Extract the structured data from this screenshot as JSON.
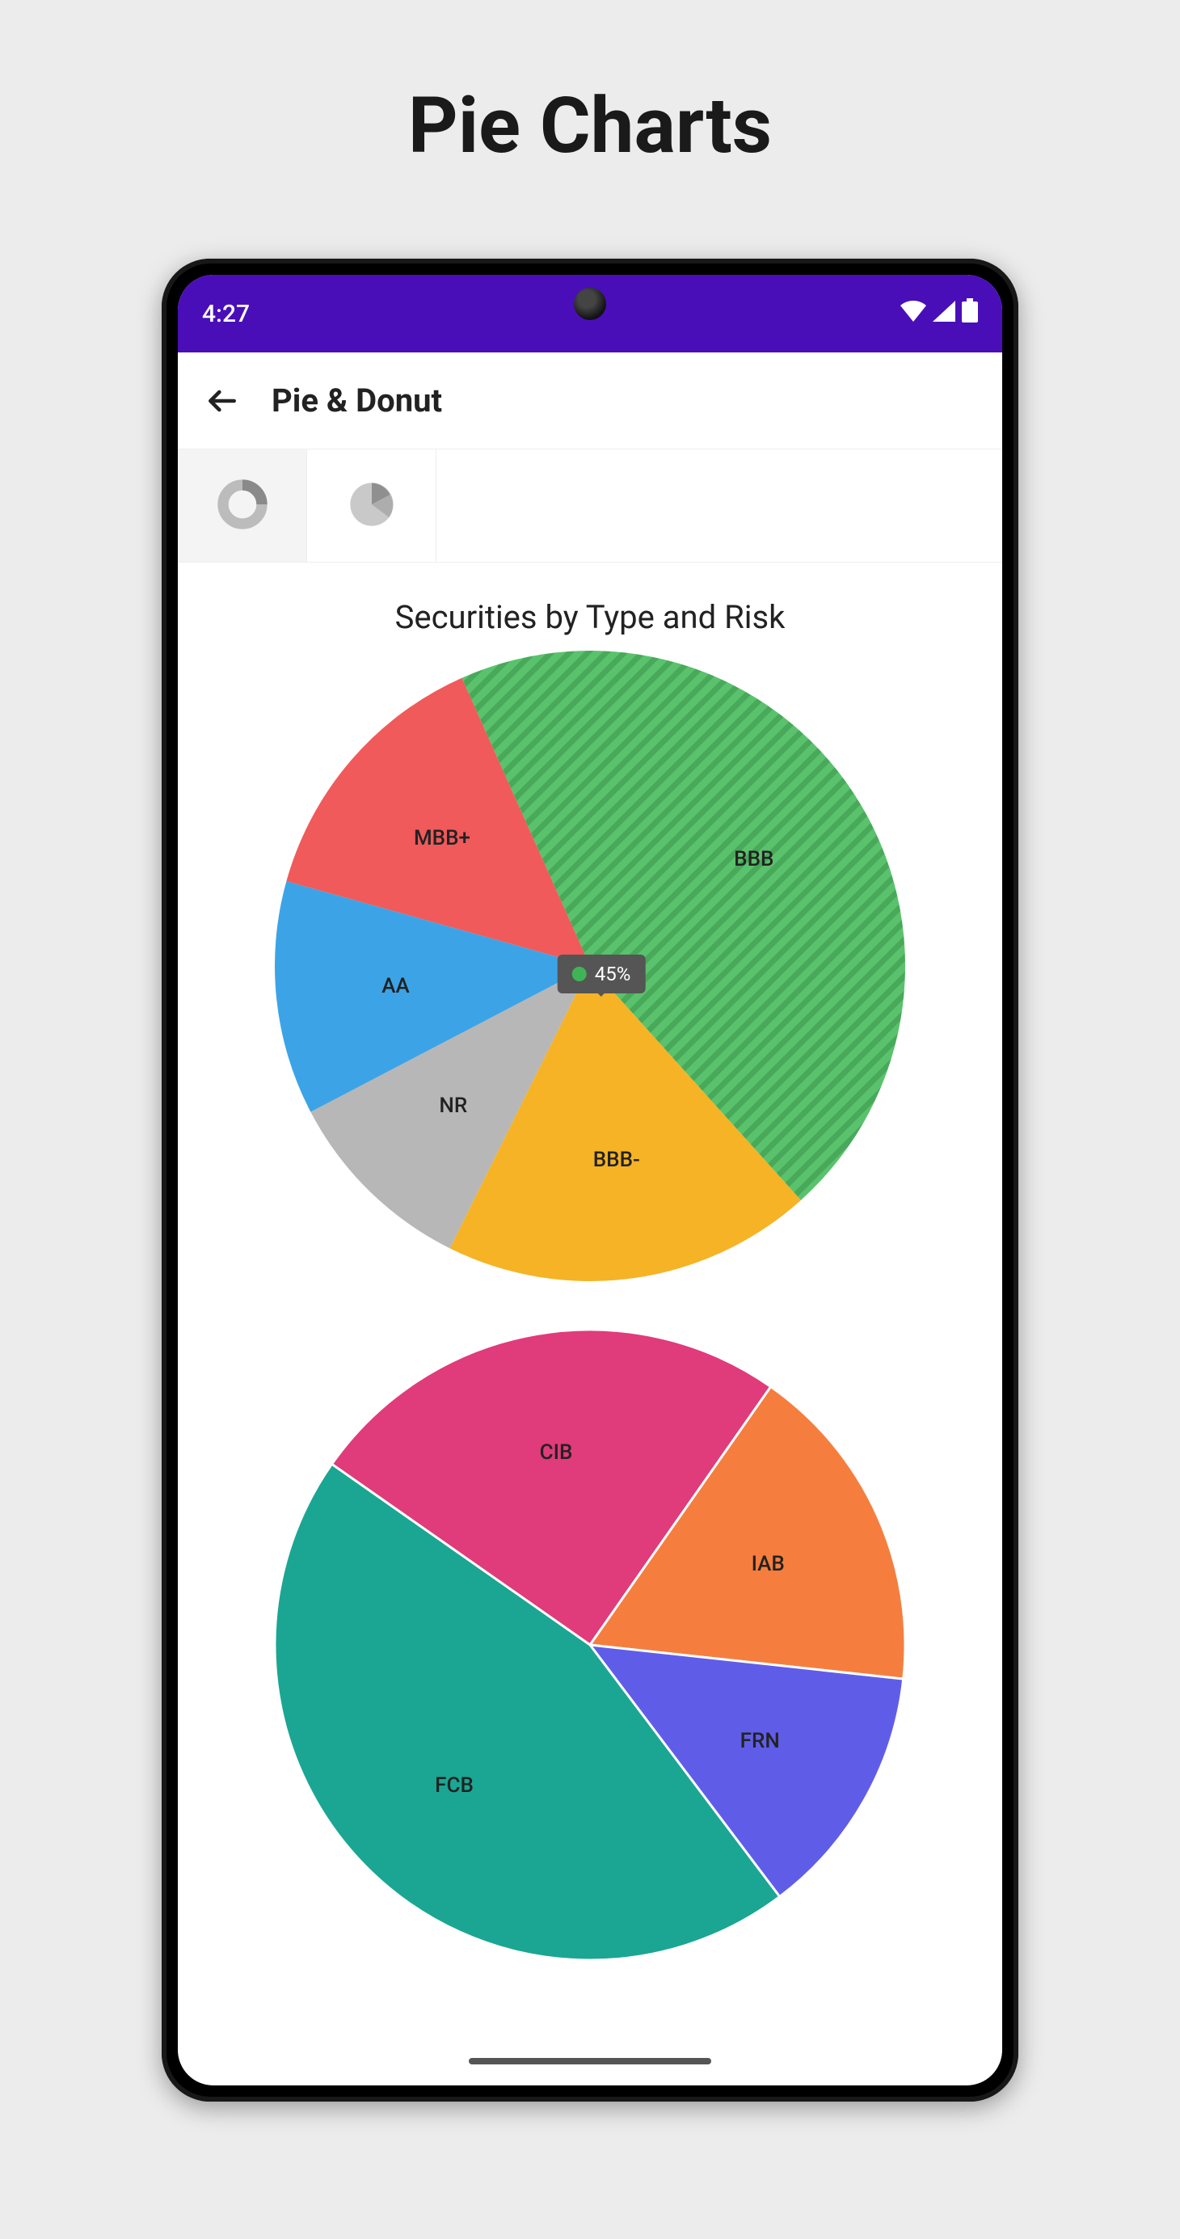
{
  "page_title": "Pie Charts",
  "statusbar": {
    "time": "4:27"
  },
  "appbar": {
    "title": "Pie & Donut"
  },
  "tabs": [
    {
      "id": "donut",
      "active": true
    },
    {
      "id": "pie",
      "active": false
    }
  ],
  "chart_title": "Securities by Type and Risk",
  "tooltip": {
    "label": "45%",
    "color": "#3fb457"
  },
  "chart_data": [
    {
      "type": "pie",
      "title": "Securities by Type and Risk",
      "series": [
        {
          "name": "BBB",
          "value": 45,
          "color": "#5ac26c",
          "hatched": true
        },
        {
          "name": "BBB-",
          "value": 19,
          "color": "#f5b325"
        },
        {
          "name": "NR",
          "value": 10,
          "color": "#b7b7b7"
        },
        {
          "name": "AA",
          "value": 12,
          "color": "#3ca4e6"
        },
        {
          "name": "MBB+",
          "value": 14,
          "color": "#f05a5a"
        }
      ]
    },
    {
      "type": "pie",
      "series": [
        {
          "name": "CIB",
          "value": 25,
          "color": "#e03b7a"
        },
        {
          "name": "IAB",
          "value": 17,
          "color": "#f57e3e"
        },
        {
          "name": "FRN",
          "value": 13,
          "color": "#5f5de8"
        },
        {
          "name": "FCB",
          "value": 45,
          "color": "#1aa693"
        }
      ]
    }
  ]
}
